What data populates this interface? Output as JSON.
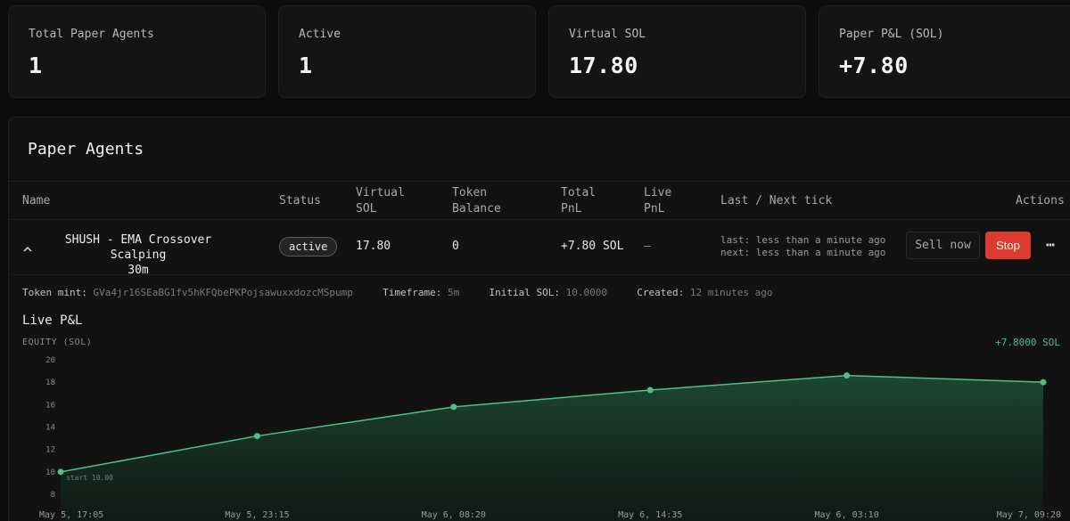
{
  "stats": [
    {
      "label": "Total Paper Agents",
      "value": "1"
    },
    {
      "label": "Active",
      "value": "1"
    },
    {
      "label": "Virtual SOL",
      "value": "17.80"
    },
    {
      "label": "Paper P&L (SOL)",
      "value": "+7.80"
    }
  ],
  "panel": {
    "title": "Paper Agents",
    "columns": {
      "name": "Name",
      "status": "Status",
      "virtual_sol_1": "Virtual",
      "virtual_sol_2": "SOL",
      "token_balance_1": "Token",
      "token_balance_2": "Balance",
      "total_pnl_1": "Total",
      "total_pnl_2": "PnL",
      "live_pnl_1": "Live",
      "live_pnl_2": "PnL",
      "ticks": "Last / Next tick",
      "actions": "Actions"
    }
  },
  "agent": {
    "name_line1": "SHUSH - EMA Crossover Scalping",
    "name_line2": "30m",
    "status": "active",
    "virtual_sol": "17.80",
    "token_balance": "0",
    "total_pnl": "+7.80 SOL",
    "live_pnl": "—",
    "last_tick": "last: less than a minute ago",
    "next_tick": "next: less than a minute ago",
    "sell_label": "Sell now",
    "stop_label": "Stop",
    "more_label": "⋯"
  },
  "details": {
    "mint_key": "Token mint:",
    "mint_val": "GVa4jr16SEaBG1fv5hKFQbePKPojsawuxxdozcMSpump",
    "timeframe_key": "Timeframe:",
    "timeframe_val": "5m",
    "initial_key": "Initial SOL:",
    "initial_val": "10.0000",
    "created_key": "Created:",
    "created_val": "12 minutes ago"
  },
  "chart_header": {
    "title": "Live P&L",
    "ylabel": "EQUITY (SOL)",
    "current": "+7.8000 SOL"
  },
  "chart_data": {
    "type": "area",
    "x": [
      "May 5, 17:05",
      "May 5, 23:15",
      "May 6, 08:20",
      "May 6, 14:35",
      "May 6, 03:10",
      "May 7, 09:20"
    ],
    "series": [
      {
        "values": [
          10.0,
          13.2,
          15.8,
          17.3,
          18.6,
          18.0
        ]
      }
    ],
    "ylabel": "EQUITY (SOL)",
    "ylim": [
      8,
      20
    ],
    "yticks": [
      8,
      10,
      12,
      14,
      16,
      18,
      20
    ],
    "start_annotation": "start 10.00",
    "colors": {
      "line": "#4fbf8a",
      "fill": "#1b3b2c"
    }
  }
}
